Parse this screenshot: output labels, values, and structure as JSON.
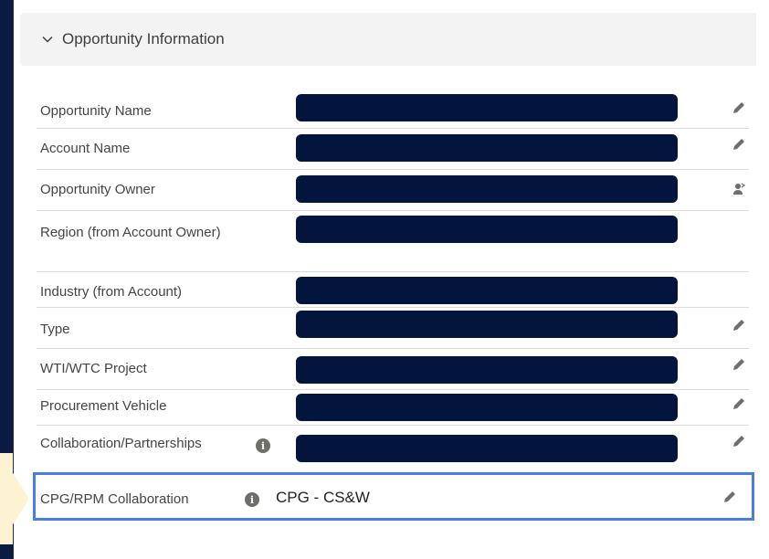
{
  "section": {
    "title": "Opportunity Information",
    "chevron_icon": "chevron-down-icon"
  },
  "fields": [
    {
      "label": "Opportunity Name",
      "value_redacted": true,
      "action_icon": "pencil-icon"
    },
    {
      "label": "Account Name",
      "value_redacted": true,
      "action_icon": "pencil-icon"
    },
    {
      "label": "Opportunity Owner",
      "value_redacted": true,
      "action_icon": "change-owner-icon"
    },
    {
      "label": "Region (from Account Owner)",
      "value_redacted": true
    },
    {
      "label": "Industry (from Account)",
      "value_redacted": true
    },
    {
      "label": "Type",
      "value_redacted": true,
      "action_icon": "pencil-icon"
    },
    {
      "label": "WTI/WTC Project",
      "value_redacted": true,
      "action_icon": "pencil-icon"
    },
    {
      "label": "Procurement Vehicle",
      "value_redacted": true,
      "action_icon": "pencil-icon"
    },
    {
      "label": "Collaboration/Partnerships",
      "value_redacted": true,
      "action_icon": "pencil-icon",
      "info_icon": true
    },
    {
      "label": "CPG/RPM Collaboration",
      "value": "CPG - CS&W",
      "action_icon": "pencil-icon",
      "info_icon": true
    }
  ],
  "colors": {
    "frame": "#0b1a40",
    "redaction": "#03153d",
    "highlight": "#4a7de2",
    "callout": "#fdf3d2"
  }
}
